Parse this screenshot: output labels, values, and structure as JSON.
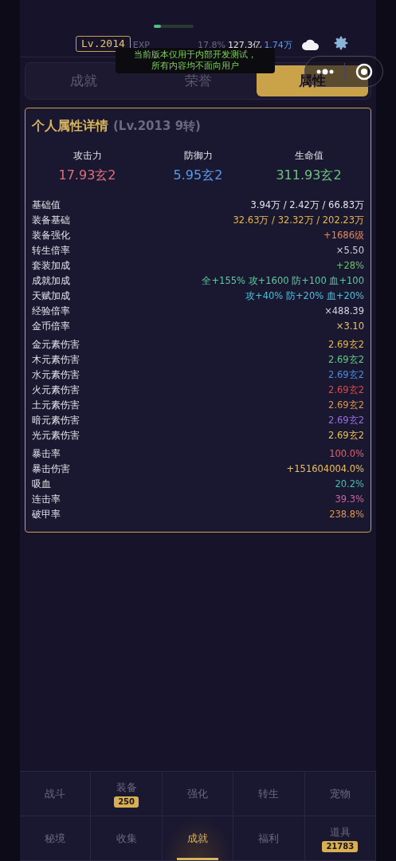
{
  "header": {
    "level": "Lv.2014",
    "exp_label": "EXP",
    "exp": {
      "level": 0.178
    },
    "exp_percent": "17.8%",
    "currency_1": "127.3亿",
    "currency_2": "1.74万"
  },
  "dev_notice": [
    "当前版本仅用于内部开发测试，",
    "所有内容均不面向用户"
  ],
  "tabs": [
    {
      "label": "成就",
      "selected": false
    },
    {
      "label": "荣誉",
      "selected": false
    },
    {
      "label": "属性",
      "selected": true
    }
  ],
  "card": {
    "title": "个人属性详情",
    "subtitle": "(Lv.2013 9转)",
    "main_stats": [
      {
        "label": "攻击力",
        "value": "17.93玄2",
        "color": "#e0707a"
      },
      {
        "label": "防御力",
        "value": "5.95玄2",
        "color": "#5b9be8"
      },
      {
        "label": "生命值",
        "value": "311.93玄2",
        "color": "#6cc47e"
      }
    ],
    "groups": [
      [
        {
          "label": "基础值",
          "value": "3.94万 / 2.42万 / 66.83万",
          "color": "#e4e4ea"
        },
        {
          "label": "装备基础",
          "value": "32.63万 / 32.32万 / 202.23万",
          "color": "#e8b84a"
        },
        {
          "label": "装备强化",
          "value": "+1686级",
          "color": "#e08a5a"
        },
        {
          "label": "转生倍率",
          "value": "×5.50",
          "color": "#d4d4dc"
        },
        {
          "label": "套装加成",
          "value": "+28%",
          "color": "#6cc070"
        },
        {
          "label": "成就加成",
          "value": "全+155% 攻+1600 防+100 血+100",
          "color": "#5fc9a0"
        },
        {
          "label": "天赋加成",
          "value": "攻+40% 防+20% 血+20%",
          "color": "#4fbfd8"
        },
        {
          "label": "经验倍率",
          "value": "×488.39",
          "color": "#d4d4dc"
        },
        {
          "label": "金币倍率",
          "value": "×3.10",
          "color": "#e8c46a"
        }
      ],
      [
        {
          "label": "金元素伤害",
          "value": "2.69玄2",
          "color": "#e8b84a"
        },
        {
          "label": "木元素伤害",
          "value": "2.69玄2",
          "color": "#5fcf80"
        },
        {
          "label": "水元素伤害",
          "value": "2.69玄2",
          "color": "#4a8ee0"
        },
        {
          "label": "火元素伤害",
          "value": "2.69玄2",
          "color": "#e04848"
        },
        {
          "label": "土元素伤害",
          "value": "2.69玄2",
          "color": "#e0944a"
        },
        {
          "label": "暗元素伤害",
          "value": "2.69玄2",
          "color": "#9a70e0"
        },
        {
          "label": "光元素伤害",
          "value": "2.69玄2",
          "color": "#e8c050"
        }
      ],
      [
        {
          "label": "暴击率",
          "value": "100.0%",
          "color": "#e06070"
        },
        {
          "label": "暴击伤害",
          "value": "+151604004.0%",
          "color": "#e8c060"
        },
        {
          "label": "吸血",
          "value": "20.2%",
          "color": "#40c0b0"
        },
        {
          "label": "连击率",
          "value": "39.3%",
          "color": "#d060a0"
        },
        {
          "label": "破甲率",
          "value": "238.8%",
          "color": "#e0944a"
        }
      ]
    ]
  },
  "bottom_nav": [
    {
      "label": "战斗",
      "selected": false
    },
    {
      "label": "装备",
      "badge": "250",
      "selected": false
    },
    {
      "label": "强化",
      "selected": false
    },
    {
      "label": "转生",
      "selected": false
    },
    {
      "label": "宠物",
      "selected": false
    },
    {
      "label": "秘境",
      "selected": false
    },
    {
      "label": "收集",
      "selected": false
    },
    {
      "label": "成就",
      "selected": true
    },
    {
      "label": "福利",
      "selected": false
    },
    {
      "label": "道具",
      "badge": "21783",
      "selected": false
    }
  ]
}
